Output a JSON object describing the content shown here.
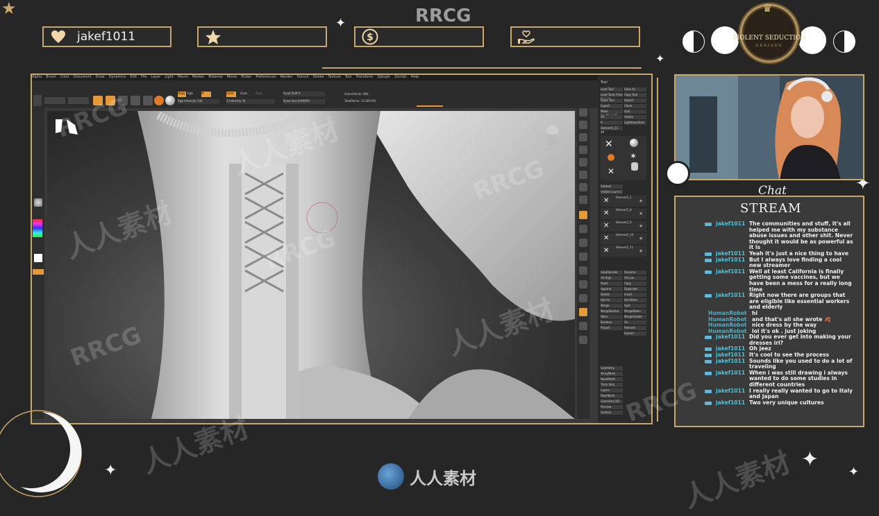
{
  "top_label": "RRCG",
  "overlay": {
    "boxes": [
      {
        "icon": "heart-icon",
        "text": "jakef1011"
      },
      {
        "icon": "star-icon",
        "text": ""
      },
      {
        "icon": "dollar-coin-icon",
        "text": ""
      },
      {
        "icon": "heart-hand-icon",
        "text": ""
      }
    ],
    "logo_line1": "VIOLENT SEDUCTION",
    "logo_line2": "DESIGNS"
  },
  "chat": {
    "title_script": "Chat",
    "title": "STREAM",
    "messages": [
      {
        "user": "jakef1011",
        "badge": true,
        "text": "The communities and stuff, it's all helped me with my substance abuse issues and other shit. Never thought it would be as powerful as it is"
      },
      {
        "user": "jakef1011",
        "badge": true,
        "text": "Yeah it's just a nice thing to have"
      },
      {
        "user": "jakef1011",
        "badge": true,
        "text": "But I always love finding a cool new streamer"
      },
      {
        "user": "jakef1011",
        "badge": true,
        "text": "Well at least California is finally getting some vaccines, but we have been a mess for a really long time"
      },
      {
        "user": "jakef1011",
        "badge": true,
        "text": "Right now there are groups that are eligible like essential workers and elderly"
      },
      {
        "user": "HumanRobot",
        "badge": false,
        "text": "hi"
      },
      {
        "user": "HumanRobot",
        "badge": false,
        "text": "and that's all she wrote 🍂"
      },
      {
        "user": "HumanRobot",
        "badge": false,
        "text": "nice dress by the way"
      },
      {
        "user": "HumanRobot",
        "badge": false,
        "text": "lol it's ok . just joking"
      },
      {
        "user": "jakef1011",
        "badge": true,
        "text": "Did you ever get into making your dresses irl?"
      },
      {
        "user": "jakef1011",
        "badge": true,
        "text": "Oh jeez"
      },
      {
        "user": "jakef1011",
        "badge": true,
        "text": "It's cool to see the process"
      },
      {
        "user": "jakef1011",
        "badge": true,
        "text": "Sounds like you used to do a lot of traveling"
      },
      {
        "user": "jakef1011",
        "badge": true,
        "text": "When i was still drawing i always wanted to do some studies in different countries"
      },
      {
        "user": "jakef1011",
        "badge": true,
        "text": "I really really wanted to go to Italy and Japan"
      },
      {
        "user": "jakef1011",
        "badge": true,
        "text": "Two very unique cultures"
      }
    ]
  },
  "zbrush": {
    "menu": [
      "Alpha",
      "Brush",
      "Color",
      "Document",
      "Draw",
      "Dynamics",
      "Edit",
      "File",
      "Layer",
      "Light",
      "Macro",
      "Marker",
      "Material",
      "Movie",
      "Picker",
      "Preferences",
      "Render",
      "Stencil",
      "Stroke",
      "Texture",
      "Tool",
      "Transform",
      "Zplugin",
      "Zscript",
      "Help"
    ],
    "toolbar": {
      "focal_shift": "Focal Shift 0",
      "draw_size": "Draw Size 8.96859",
      "zintensity": "Z Intensity 31",
      "rgb_intensity": "Rgb Intensity 100",
      "active_points": "ActivePoints: 806",
      "total_points": "TotalPoints: 12.609 Mil",
      "mrgb": "Mrgb",
      "rgb": "Rgb",
      "m": "M",
      "zadd": "Zadd",
      "zsub": "Zsub",
      "zcut": "Zcut"
    },
    "tray_title": "Tool",
    "tray_buttons": [
      "Load Tool",
      "Save As",
      "Load Tools From Project",
      "Copy Tool",
      "Paste Tool",
      "Import",
      "Export",
      "Clone",
      "Make PolyMesh3D",
      "GoZ",
      "All",
      "Visible",
      "R",
      "Lightbox▸Tools",
      "Sleeves5_11. 48",
      "Subtool",
      "Visible Count 5",
      "Rename",
      "AutoReorder",
      "All Low",
      "All High",
      "Copy",
      "Paste",
      "Duplicate",
      "Append",
      "Insert",
      "Delete",
      "Del Other",
      "Del All",
      "Split",
      "Merge",
      "MergeDown",
      "MergeSimilar",
      "MergeVisible",
      "Weld",
      "Uv",
      "Boolean",
      "Remesh",
      "Project",
      "Extract",
      "Geometry",
      "ArrayMesh",
      "NanoMesh",
      "Thick Skin",
      "Layers",
      "FiberMesh",
      "Geometry HD",
      "Preview",
      "Surface"
    ],
    "subtools": [
      "Sleeves5_2",
      "Sleeves5_8",
      "Sleeves5_9",
      "Sleeves5_10",
      "Sleeves5_11"
    ]
  },
  "watermarks": [
    "RRCG",
    "人人素材"
  ],
  "footer_logo": "人人素材"
}
